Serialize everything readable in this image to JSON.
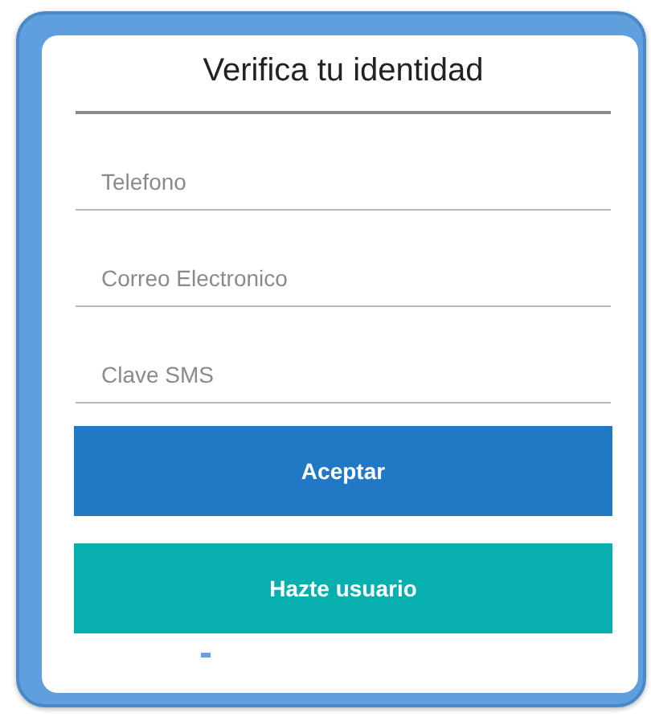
{
  "title": "Verifica tu identidad",
  "fields": [
    {
      "placeholder": "Telefono"
    },
    {
      "placeholder": "Correo Electronico"
    },
    {
      "placeholder": "Clave SMS"
    }
  ],
  "buttons": [
    {
      "label": "Aceptar",
      "kind": "primary"
    },
    {
      "label": "Hazte usuario",
      "kind": "secondary"
    }
  ]
}
